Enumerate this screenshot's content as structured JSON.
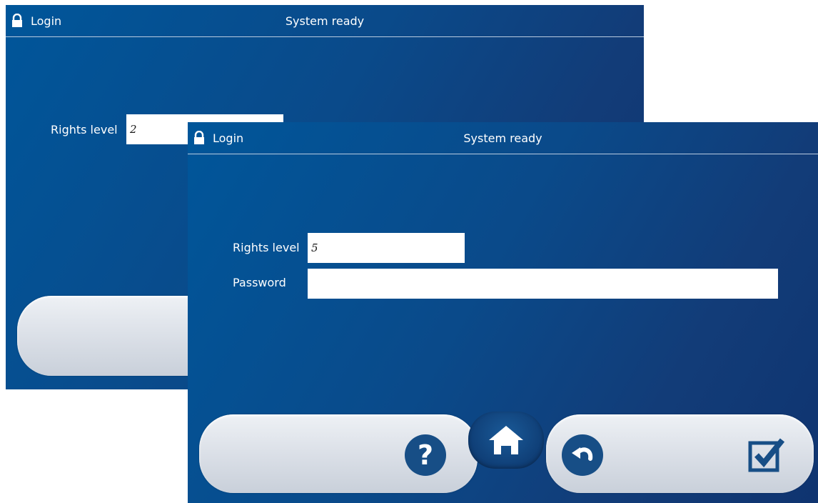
{
  "back_screen": {
    "title": "Login",
    "status": "System ready",
    "rights_level_label": "Rights level",
    "rights_level_value": "2"
  },
  "front_screen": {
    "title": "Login",
    "status": "System ready",
    "rights_level_label": "Rights level",
    "rights_level_value": "5",
    "password_label": "Password",
    "password_value": "",
    "toolbar": {
      "help_icon": "question-mark-icon",
      "home_icon": "home-icon",
      "back_icon": "undo-arrow-icon",
      "confirm_icon": "checkbox-check-icon"
    }
  },
  "colors": {
    "panel_blue": "#0a4a8a",
    "button_blue": "#174e86",
    "pill_gray": "#d9dee6"
  }
}
